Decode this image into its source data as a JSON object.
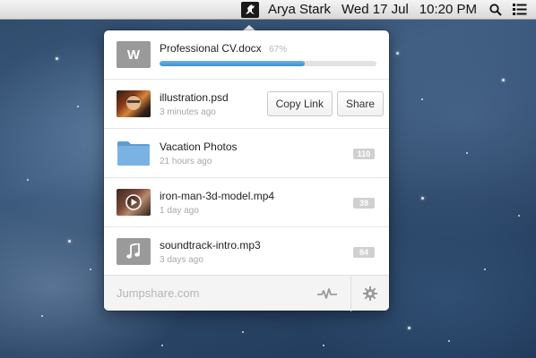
{
  "menubar": {
    "app_icon": "jumpshare-kangaroo-icon",
    "user_name": "Arya Stark",
    "date": "Wed 17 Jul",
    "time": "10:20 PM",
    "search_icon": "search-icon",
    "list_icon": "list-menu-icon"
  },
  "upload": {
    "filename": "Professional CV.docx",
    "percent_label": "67%",
    "progress": 0.67,
    "file_type_icon": "word-document-icon",
    "file_type_letter": "W"
  },
  "files": [
    {
      "name": "illustration.psd",
      "time": "3 minutes ago",
      "icon": "image-thumbnail",
      "actions": {
        "copy_link": "Copy Link",
        "share": "Share"
      }
    },
    {
      "name": "Vacation Photos",
      "time": "21 hours ago",
      "icon": "folder-icon",
      "count": "110"
    },
    {
      "name": "iron-man-3d-model.mp4",
      "time": "1 day ago",
      "icon": "video-thumbnail",
      "count": "39"
    },
    {
      "name": "soundtrack-intro.mp3",
      "time": "3 days ago",
      "icon": "music-note-icon",
      "count": "84"
    }
  ],
  "footer": {
    "brand": "Jumpshare.com",
    "activity_icon": "activity-pulse-icon",
    "settings_icon": "gear-icon"
  },
  "colors": {
    "progress": "#4a96d6",
    "folder": "#6aa6d9",
    "badge": "#d0d0d0"
  }
}
